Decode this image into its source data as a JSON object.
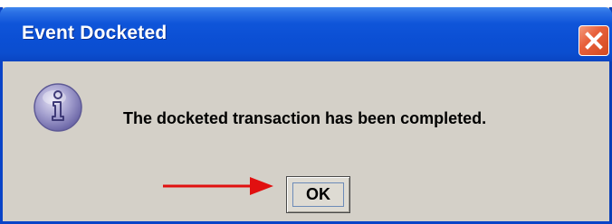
{
  "dialog": {
    "title": "Event Docketed",
    "message": "The docketed transaction has been completed.",
    "ok_label": "OK"
  },
  "icons": {
    "close": "close-icon",
    "info": "information-icon",
    "annotation": "red-arrow-icon"
  },
  "colors": {
    "title_bar": "#0b4fd4",
    "close_button": "#e8603b",
    "dialog_background": "#d4d0c8",
    "annotation_arrow": "#e11010"
  }
}
